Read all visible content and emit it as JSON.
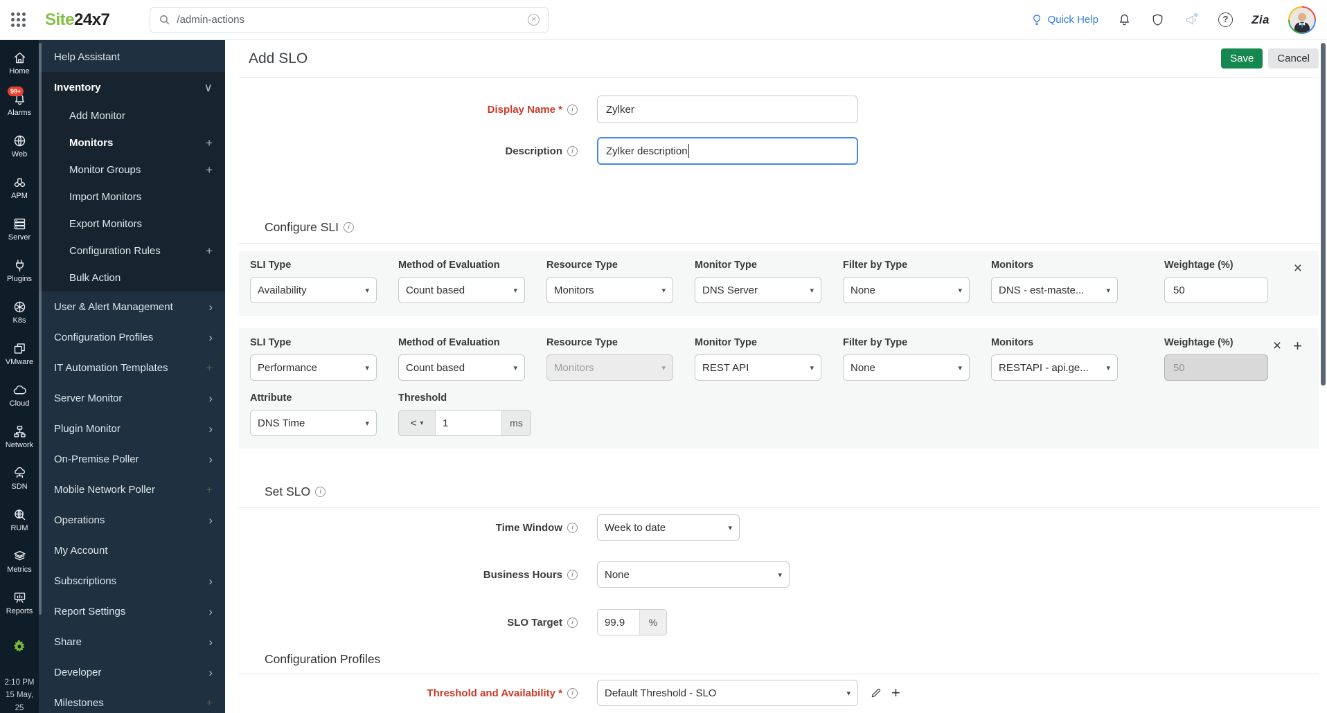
{
  "topbar": {
    "logo_part1": "Site",
    "logo_part2": "24x7",
    "search_value": "/admin-actions",
    "quick_help_label": "Quick Help",
    "zia_label": "Zia"
  },
  "rail": {
    "items": [
      {
        "icon": "home",
        "label": "Home"
      },
      {
        "icon": "alarms",
        "label": "Alarms",
        "badge": "99+"
      },
      {
        "icon": "web",
        "label": "Web"
      },
      {
        "icon": "apm",
        "label": "APM"
      },
      {
        "icon": "server",
        "label": "Server"
      },
      {
        "icon": "plugins",
        "label": "Plugins"
      },
      {
        "icon": "k8s",
        "label": "K8s"
      },
      {
        "icon": "vmware",
        "label": "VMware"
      },
      {
        "icon": "cloud",
        "label": "Cloud"
      },
      {
        "icon": "network",
        "label": "Network"
      },
      {
        "icon": "sdn",
        "label": "SDN"
      },
      {
        "icon": "rum",
        "label": "RUM"
      },
      {
        "icon": "metrics",
        "label": "Metrics"
      },
      {
        "icon": "reports",
        "label": "Reports"
      }
    ],
    "time": "2:10 PM",
    "date": "15 May, 25"
  },
  "sidebar": {
    "items": [
      {
        "label": "Help Assistant"
      },
      {
        "label": "Inventory",
        "bold": true,
        "group": true,
        "accessory": "chevron-down"
      },
      {
        "label": "Add Monitor",
        "sub": true,
        "group": true
      },
      {
        "label": "Monitors",
        "sub": true,
        "bold": true,
        "group": true,
        "accessory": "plus"
      },
      {
        "label": "Monitor Groups",
        "sub": true,
        "group": true,
        "accessory": "plus"
      },
      {
        "label": "Import Monitors",
        "sub": true,
        "group": true
      },
      {
        "label": "Export Monitors",
        "sub": true,
        "group": true
      },
      {
        "label": "Configuration Rules",
        "sub": true,
        "group": true,
        "accessory": "plus"
      },
      {
        "label": "Bulk Action",
        "sub": true,
        "group": true
      },
      {
        "label": "User & Alert Management",
        "accessory": "chevron-right"
      },
      {
        "label": "Configuration Profiles",
        "accessory": "chevron-right"
      },
      {
        "label": "IT Automation Templates",
        "accessory": "plus",
        "dim": true
      },
      {
        "label": "Server Monitor",
        "accessory": "chevron-right"
      },
      {
        "label": "Plugin Monitor",
        "accessory": "chevron-right"
      },
      {
        "label": "On-Premise Poller",
        "accessory": "chevron-right"
      },
      {
        "label": "Mobile Network Poller",
        "accessory": "plus",
        "dim": true
      },
      {
        "label": "Operations",
        "accessory": "chevron-right"
      },
      {
        "label": "My Account"
      },
      {
        "label": "Subscriptions",
        "accessory": "chevron-right"
      },
      {
        "label": "Report Settings",
        "accessory": "chevron-right"
      },
      {
        "label": "Share",
        "accessory": "chevron-right"
      },
      {
        "label": "Developer",
        "accessory": "chevron-right"
      },
      {
        "label": "Milestones",
        "accessory": "plus",
        "dim": true
      }
    ]
  },
  "main": {
    "title": "Add SLO",
    "save_label": "Save",
    "cancel_label": "Cancel",
    "display_name": {
      "label": "Display Name *",
      "value": "Zylker"
    },
    "description": {
      "label": "Description",
      "value": "Zylker description"
    },
    "configure_sli_heading": "Configure SLI",
    "sli_rows": [
      {
        "selects": [
          {
            "label": "SLI Type",
            "value": "Availability"
          },
          {
            "label": "Method of Evaluation",
            "value": "Count based"
          },
          {
            "label": "Resource Type",
            "value": "Monitors"
          },
          {
            "label": "Monitor Type",
            "value": "DNS Server"
          },
          {
            "label": "Filter by Type",
            "value": "None"
          },
          {
            "label": "Monitors",
            "value": "DNS - est-maste..."
          }
        ],
        "weightage": {
          "label": "Weightage (%)",
          "value": "50"
        }
      },
      {
        "selects": [
          {
            "label": "SLI Type",
            "value": "Performance"
          },
          {
            "label": "Method of Evaluation",
            "value": "Count based"
          },
          {
            "label": "Resource Type",
            "value": "Monitors",
            "disabled": true
          },
          {
            "label": "Monitor Type",
            "value": "REST API"
          },
          {
            "label": "Filter by Type",
            "value": "None"
          },
          {
            "label": "Monitors",
            "value": "RESTAPI - api.ge..."
          }
        ],
        "weightage": {
          "label": "Weightage (%)",
          "value": "50",
          "disabled": true
        },
        "attribute": {
          "label": "Attribute",
          "value": "DNS Time"
        },
        "threshold": {
          "label": "Threshold",
          "operator": "<",
          "value": "1",
          "unit": "ms"
        }
      }
    ],
    "set_slo": {
      "heading": "Set SLO",
      "time_window": {
        "label": "Time Window",
        "value": "Week to date"
      },
      "business_hours": {
        "label": "Business Hours",
        "value": "None"
      },
      "slo_target": {
        "label": "SLO Target",
        "value": "99.9",
        "unit": "%"
      }
    },
    "configuration_profiles": {
      "heading": "Configuration Profiles",
      "threshold_availability": {
        "label": "Threshold and Availability *",
        "value": "Default Threshold - SLO"
      }
    }
  },
  "colors": {
    "brand_green": "#83bf40",
    "save_green": "#15884f",
    "required_red": "#cb3a28",
    "link_blue": "#2f7ce0",
    "sidebar_dark": "#0f1d29",
    "sidebar_menu": "#1f3041"
  }
}
